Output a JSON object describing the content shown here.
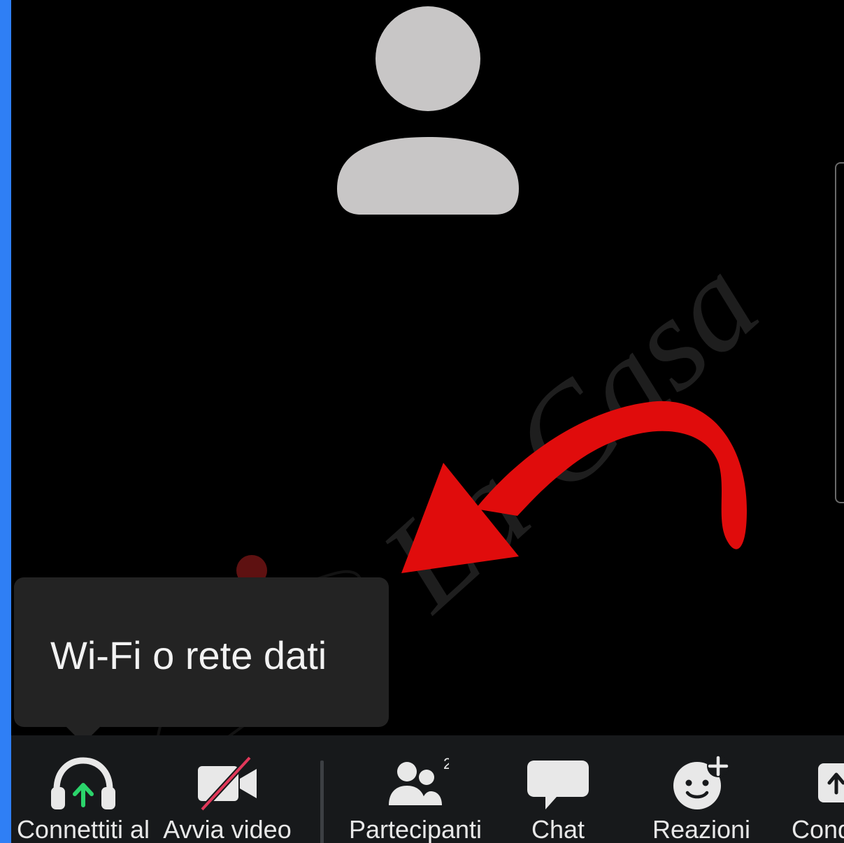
{
  "tooltip": {
    "text": "Wi-Fi o rete dati"
  },
  "toolbar": {
    "items": [
      {
        "label": "Connettiti al",
        "icon": "headphones-upload-icon"
      },
      {
        "label": "Avvia video",
        "icon": "video-off-icon"
      },
      {
        "label": "Partecipanti",
        "icon": "participants-icon",
        "badge": "2"
      },
      {
        "label": "Chat",
        "icon": "chat-bubble-icon"
      },
      {
        "label": "Reazioni",
        "icon": "reaction-add-icon"
      },
      {
        "label": "Cond",
        "icon": "share-icon"
      }
    ]
  },
  "watermark": {
    "text": "La Casa"
  },
  "colors": {
    "accent": "#2f7ff5",
    "tooltip_bg": "#232323",
    "toolbar_bg": "#17191b",
    "annotation_red": "#e00c0c",
    "connect_green": "#2bd46b",
    "video_off_red": "#e2385a",
    "avatar_gray": "#c8c6c6"
  }
}
